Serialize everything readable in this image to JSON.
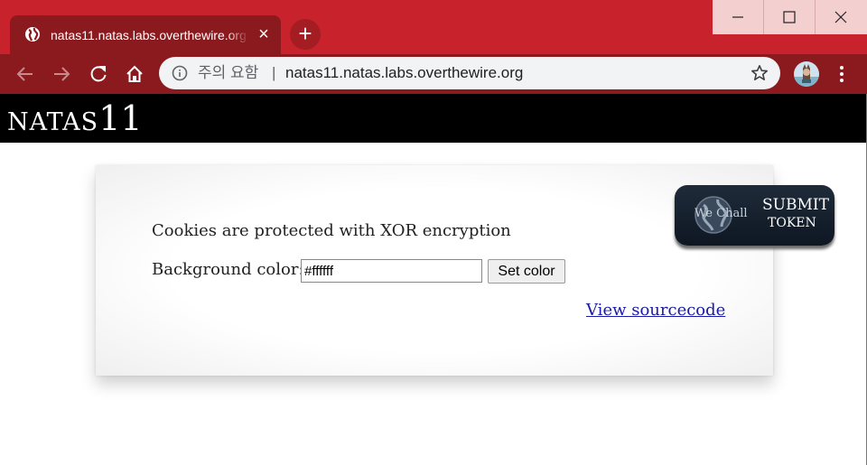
{
  "browser": {
    "tab_title": "natas11.natas.labs.overthewire.org",
    "security_label": "주의 요함",
    "url_separator": "|",
    "url": "natas11.natas.labs.overthewire.org",
    "theme_color": "#c8232c",
    "icons": [
      "globe-icon",
      "close-icon",
      "plus-icon",
      "back-icon",
      "forward-icon",
      "reload-icon",
      "home-icon",
      "info-icon",
      "star-icon",
      "menu-icon"
    ]
  },
  "page": {
    "title_prefix": "NATAS",
    "title_number": "11",
    "info_text": "Cookies are protected with XOR encryption",
    "bg_label": "Background color:",
    "bg_value": "#ffffff",
    "set_color_label": "Set color",
    "view_source_label": "View sourcecode",
    "wechall": {
      "logo_text": "We Chall",
      "submit_line1": "SUBMIT",
      "submit_line2": "TOKEN"
    }
  }
}
